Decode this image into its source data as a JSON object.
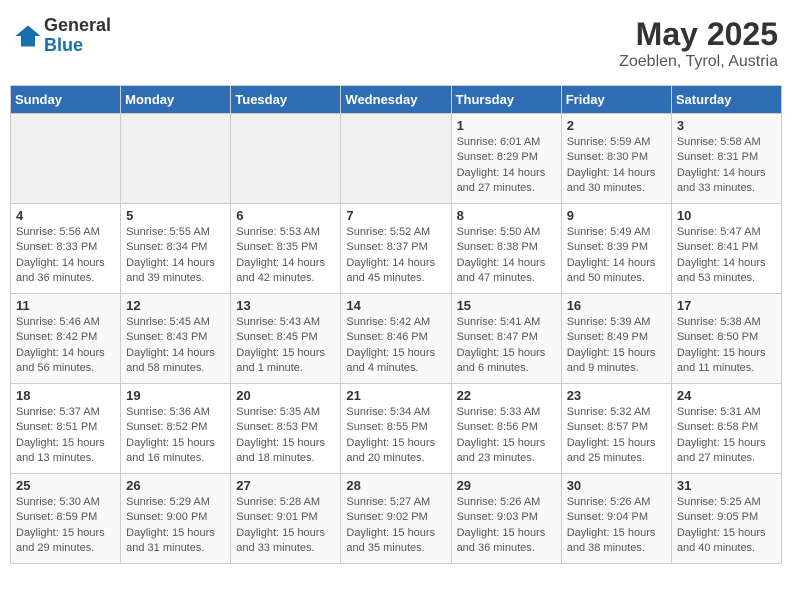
{
  "header": {
    "logo_general": "General",
    "logo_blue": "Blue",
    "month_year": "May 2025",
    "location": "Zoeblen, Tyrol, Austria"
  },
  "days_of_week": [
    "Sunday",
    "Monday",
    "Tuesday",
    "Wednesday",
    "Thursday",
    "Friday",
    "Saturday"
  ],
  "weeks": [
    [
      {
        "day": "",
        "info": ""
      },
      {
        "day": "",
        "info": ""
      },
      {
        "day": "",
        "info": ""
      },
      {
        "day": "",
        "info": ""
      },
      {
        "day": "1",
        "info": "Sunrise: 6:01 AM\nSunset: 8:29 PM\nDaylight: 14 hours\nand 27 minutes."
      },
      {
        "day": "2",
        "info": "Sunrise: 5:59 AM\nSunset: 8:30 PM\nDaylight: 14 hours\nand 30 minutes."
      },
      {
        "day": "3",
        "info": "Sunrise: 5:58 AM\nSunset: 8:31 PM\nDaylight: 14 hours\nand 33 minutes."
      }
    ],
    [
      {
        "day": "4",
        "info": "Sunrise: 5:56 AM\nSunset: 8:33 PM\nDaylight: 14 hours\nand 36 minutes."
      },
      {
        "day": "5",
        "info": "Sunrise: 5:55 AM\nSunset: 8:34 PM\nDaylight: 14 hours\nand 39 minutes."
      },
      {
        "day": "6",
        "info": "Sunrise: 5:53 AM\nSunset: 8:35 PM\nDaylight: 14 hours\nand 42 minutes."
      },
      {
        "day": "7",
        "info": "Sunrise: 5:52 AM\nSunset: 8:37 PM\nDaylight: 14 hours\nand 45 minutes."
      },
      {
        "day": "8",
        "info": "Sunrise: 5:50 AM\nSunset: 8:38 PM\nDaylight: 14 hours\nand 47 minutes."
      },
      {
        "day": "9",
        "info": "Sunrise: 5:49 AM\nSunset: 8:39 PM\nDaylight: 14 hours\nand 50 minutes."
      },
      {
        "day": "10",
        "info": "Sunrise: 5:47 AM\nSunset: 8:41 PM\nDaylight: 14 hours\nand 53 minutes."
      }
    ],
    [
      {
        "day": "11",
        "info": "Sunrise: 5:46 AM\nSunset: 8:42 PM\nDaylight: 14 hours\nand 56 minutes."
      },
      {
        "day": "12",
        "info": "Sunrise: 5:45 AM\nSunset: 8:43 PM\nDaylight: 14 hours\nand 58 minutes."
      },
      {
        "day": "13",
        "info": "Sunrise: 5:43 AM\nSunset: 8:45 PM\nDaylight: 15 hours\nand 1 minute."
      },
      {
        "day": "14",
        "info": "Sunrise: 5:42 AM\nSunset: 8:46 PM\nDaylight: 15 hours\nand 4 minutes."
      },
      {
        "day": "15",
        "info": "Sunrise: 5:41 AM\nSunset: 8:47 PM\nDaylight: 15 hours\nand 6 minutes."
      },
      {
        "day": "16",
        "info": "Sunrise: 5:39 AM\nSunset: 8:49 PM\nDaylight: 15 hours\nand 9 minutes."
      },
      {
        "day": "17",
        "info": "Sunrise: 5:38 AM\nSunset: 8:50 PM\nDaylight: 15 hours\nand 11 minutes."
      }
    ],
    [
      {
        "day": "18",
        "info": "Sunrise: 5:37 AM\nSunset: 8:51 PM\nDaylight: 15 hours\nand 13 minutes."
      },
      {
        "day": "19",
        "info": "Sunrise: 5:36 AM\nSunset: 8:52 PM\nDaylight: 15 hours\nand 16 minutes."
      },
      {
        "day": "20",
        "info": "Sunrise: 5:35 AM\nSunset: 8:53 PM\nDaylight: 15 hours\nand 18 minutes."
      },
      {
        "day": "21",
        "info": "Sunrise: 5:34 AM\nSunset: 8:55 PM\nDaylight: 15 hours\nand 20 minutes."
      },
      {
        "day": "22",
        "info": "Sunrise: 5:33 AM\nSunset: 8:56 PM\nDaylight: 15 hours\nand 23 minutes."
      },
      {
        "day": "23",
        "info": "Sunrise: 5:32 AM\nSunset: 8:57 PM\nDaylight: 15 hours\nand 25 minutes."
      },
      {
        "day": "24",
        "info": "Sunrise: 5:31 AM\nSunset: 8:58 PM\nDaylight: 15 hours\nand 27 minutes."
      }
    ],
    [
      {
        "day": "25",
        "info": "Sunrise: 5:30 AM\nSunset: 8:59 PM\nDaylight: 15 hours\nand 29 minutes."
      },
      {
        "day": "26",
        "info": "Sunrise: 5:29 AM\nSunset: 9:00 PM\nDaylight: 15 hours\nand 31 minutes."
      },
      {
        "day": "27",
        "info": "Sunrise: 5:28 AM\nSunset: 9:01 PM\nDaylight: 15 hours\nand 33 minutes."
      },
      {
        "day": "28",
        "info": "Sunrise: 5:27 AM\nSunset: 9:02 PM\nDaylight: 15 hours\nand 35 minutes."
      },
      {
        "day": "29",
        "info": "Sunrise: 5:26 AM\nSunset: 9:03 PM\nDaylight: 15 hours\nand 36 minutes."
      },
      {
        "day": "30",
        "info": "Sunrise: 5:26 AM\nSunset: 9:04 PM\nDaylight: 15 hours\nand 38 minutes."
      },
      {
        "day": "31",
        "info": "Sunrise: 5:25 AM\nSunset: 9:05 PM\nDaylight: 15 hours\nand 40 minutes."
      }
    ]
  ]
}
